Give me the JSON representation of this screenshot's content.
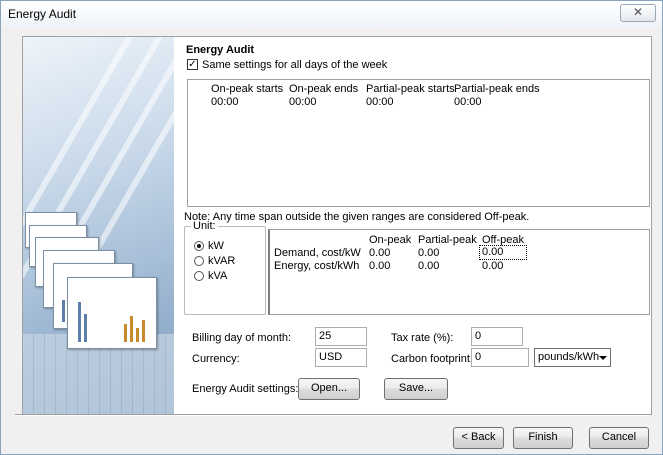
{
  "window": {
    "title": "Energy Audit",
    "close_glyph": "✕"
  },
  "section": {
    "heading": "Energy Audit",
    "same_settings_label": "Same settings for all days of the week",
    "same_settings_checked": true
  },
  "schedule": {
    "columns": [
      "On-peak starts",
      "On-peak ends",
      "Partial-peak starts",
      "Partial-peak ends"
    ],
    "row": [
      "00:00",
      "00:00",
      "00:00",
      "00:00"
    ]
  },
  "note": "Note: Any time span outside the given ranges are considered Off-peak.",
  "unit": {
    "legend": "Unit:",
    "options": [
      "kW",
      "kVAR",
      "kVA"
    ],
    "selected": "kW"
  },
  "costs": {
    "columns": [
      "On-peak",
      "Partial-peak",
      "Off-peak"
    ],
    "rows": [
      {
        "label": "Demand, cost/kW",
        "values": [
          "0.00",
          "0.00",
          "0.00"
        ]
      },
      {
        "label": "Energy, cost/kWh",
        "values": [
          "0.00",
          "0.00",
          "0.00"
        ]
      }
    ]
  },
  "billing": {
    "label": "Billing day of month:",
    "value": "25"
  },
  "currency": {
    "label": "Currency:",
    "value": "USD"
  },
  "tax": {
    "label": "Tax rate (%):",
    "value": "0"
  },
  "carbon": {
    "label": "Carbon footprint:",
    "value": "0",
    "unit_selected": "pounds/kWh"
  },
  "settings": {
    "label": "Energy Audit settings:",
    "open_label": "Open...",
    "save_label": "Save..."
  },
  "footer": {
    "back_label": "< Back",
    "finish_label": "Finish",
    "cancel_label": "Cancel"
  }
}
